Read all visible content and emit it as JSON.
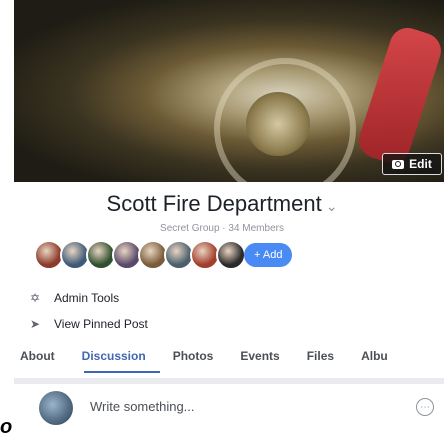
{
  "cover": {
    "edit_label": "Edit"
  },
  "group": {
    "name": "Scott Fire Department",
    "meta": "Secret Group · 34 Members"
  },
  "members": {
    "avatar_colors": [
      "#8b3a2b",
      "#3e5a78",
      "#2f4f2f",
      "#5a4a6a",
      "#7a5c3a",
      "#4b5f6e",
      "#a33d2c",
      "#2a2a2a"
    ],
    "add_label": "+ Add"
  },
  "tools": {
    "admin_label": "Admin Tools",
    "pinned_label": "View Pinned Post"
  },
  "tabs": [
    "About",
    "Discussion",
    "Photos",
    "Events",
    "Files",
    "Albu"
  ],
  "active_tab": "Discussion",
  "composer": {
    "placeholder": "Write something..."
  },
  "left_glyph": "o",
  "colors": {
    "accent": "#4267b2",
    "add_button": "#4a8af4",
    "separator": "#e9ebee"
  }
}
